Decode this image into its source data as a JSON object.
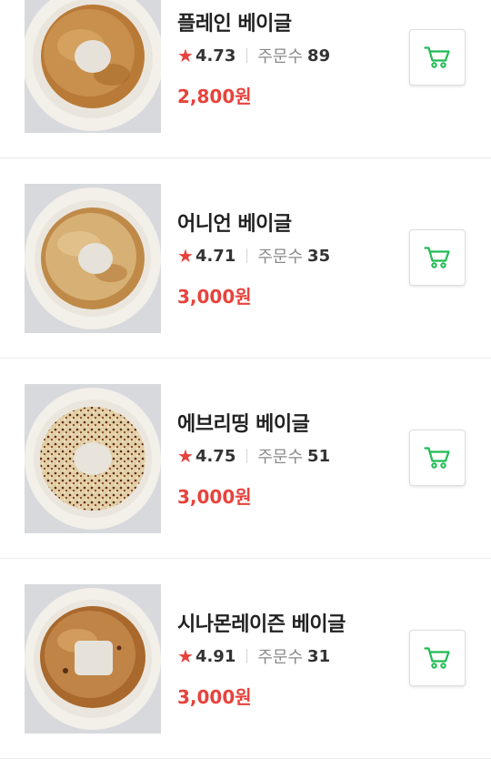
{
  "colors": {
    "accent_red": "#e8423c",
    "cart_green": "#1fbb54",
    "text_dark": "#222222",
    "text_muted": "#8a8a8a"
  },
  "products": [
    {
      "name": "플레인 베이글",
      "rating": "4.73",
      "orders_label": "주문수",
      "orders": "89",
      "price": "2,800원",
      "image": "plain-bagel"
    },
    {
      "name": "어니언 베이글",
      "rating": "4.71",
      "orders_label": "주문수",
      "orders": "35",
      "price": "3,000원",
      "image": "onion-bagel"
    },
    {
      "name": "에브리띵 베이글",
      "rating": "4.75",
      "orders_label": "주문수",
      "orders": "51",
      "price": "3,000원",
      "image": "everything-bagel"
    },
    {
      "name": "시나몬레이즌 베이글",
      "rating": "4.91",
      "orders_label": "주문수",
      "orders": "31",
      "price": "3,000원",
      "image": "cinnamon-raisin-bagel"
    }
  ],
  "icons": {
    "star": "★",
    "cart": "cart-icon"
  }
}
